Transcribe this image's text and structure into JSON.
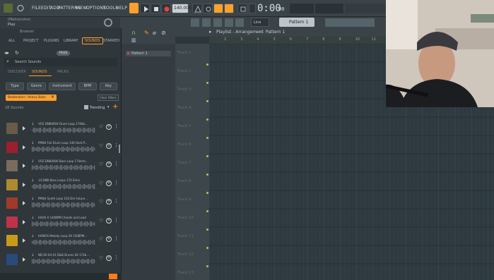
{
  "menubar": {
    "items": [
      "FILE",
      "EDIT",
      "ADD",
      "PATTERNS",
      "VIEW",
      "OPTIONS",
      "TOOLS",
      "HELP"
    ],
    "tempo": "140.000",
    "time": "0:00",
    "time_small": "00",
    "pattern_label": "Pattern 1",
    "snap_label": "Line"
  },
  "hint": {
    "line1": "(Metronome)",
    "line2": "Play"
  },
  "browser": {
    "title": "Browser",
    "tabs": [
      "ALL",
      "PROJECT",
      "PLUGINS",
      "LIBRARY",
      "SOUNDS",
      "STARRED"
    ],
    "active_tab": "SOUNDS",
    "badge": "PLUS",
    "search_placeholder": "Search Sounds",
    "subtabs": [
      "DISCOVER",
      "SOUNDS",
      "PACKS"
    ],
    "active_subtab": "SOUNDS",
    "filters": [
      "Type",
      "Genre",
      "Instrument",
      "BPM",
      "Key"
    ],
    "active_filter_chip": "Beatmaker: Heavy Bass",
    "clear_filters": "Clear Filters",
    "count": "28 Sounds",
    "sort": "Trending",
    "sounds": [
      {
        "name": "VGS DNB4004 Drum Loop 174bb...",
        "thumb": "#6a5a4a"
      },
      {
        "name": "PMSH Full Drum Loop 140 Hard P...",
        "thumb": "#9a2030"
      },
      {
        "name": "VGS DNB4006 Bass Loop 174mm...",
        "thumb": "#7b6b5a"
      },
      {
        "name": "14 DNB Bass Loops 174 Emin",
        "thumb": "#b08a30"
      },
      {
        "name": "PMSH Synth Loop 150 Dm Future...",
        "thumb": "#a13a2a"
      },
      {
        "name": "HAOS A 140BPM Chords and Lead",
        "thumb": "#c0324a"
      },
      {
        "name": "HAMOS Melody Loop 28 150BPM...",
        "thumb": "#c99a1a"
      },
      {
        "name": "ND RA Kit 01 D&B Drums 04 172b...",
        "thumb": "#2a4a7a"
      }
    ]
  },
  "pattern_panel": {
    "item": "Pattern 1"
  },
  "playlist": {
    "title": "Playlist - Arrangement",
    "pattern": "Pattern 1",
    "bars": [
      "2",
      "3",
      "4",
      "5",
      "6",
      "7",
      "8",
      "9",
      "10",
      "11"
    ],
    "tracks": [
      "Track 1",
      "Track 2",
      "Track 3",
      "Track 4",
      "Track 5",
      "Track 6",
      "Track 7",
      "Track 8",
      "Track 9",
      "Track 10",
      "Track 11",
      "Track 12",
      "Track 13"
    ]
  },
  "colors": {
    "accent": "#ff9f2e",
    "green": "#8cd94a",
    "grid": "#34424a"
  }
}
